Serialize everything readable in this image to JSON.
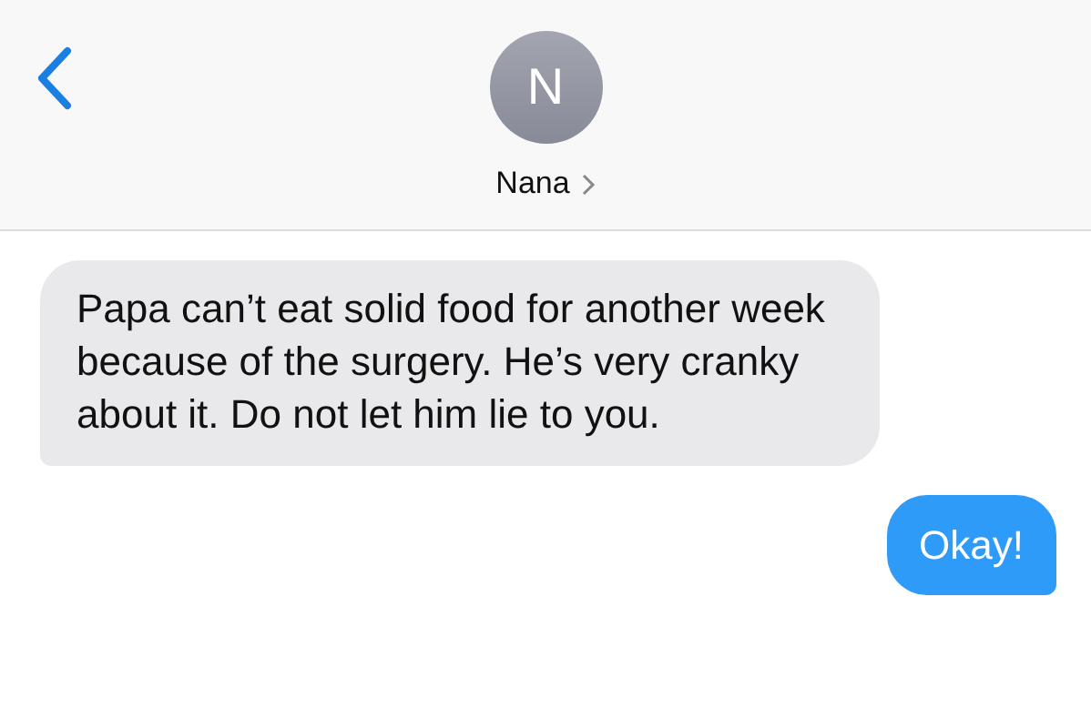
{
  "header": {
    "avatar_initial": "N",
    "contact_name": "Nana"
  },
  "messages": [
    {
      "kind": "incoming",
      "text": "Papa can’t eat solid food for another week because of the surgery. He’s very cranky about it. Do not let him lie to you."
    },
    {
      "kind": "outgoing",
      "text": "Okay!"
    }
  ]
}
